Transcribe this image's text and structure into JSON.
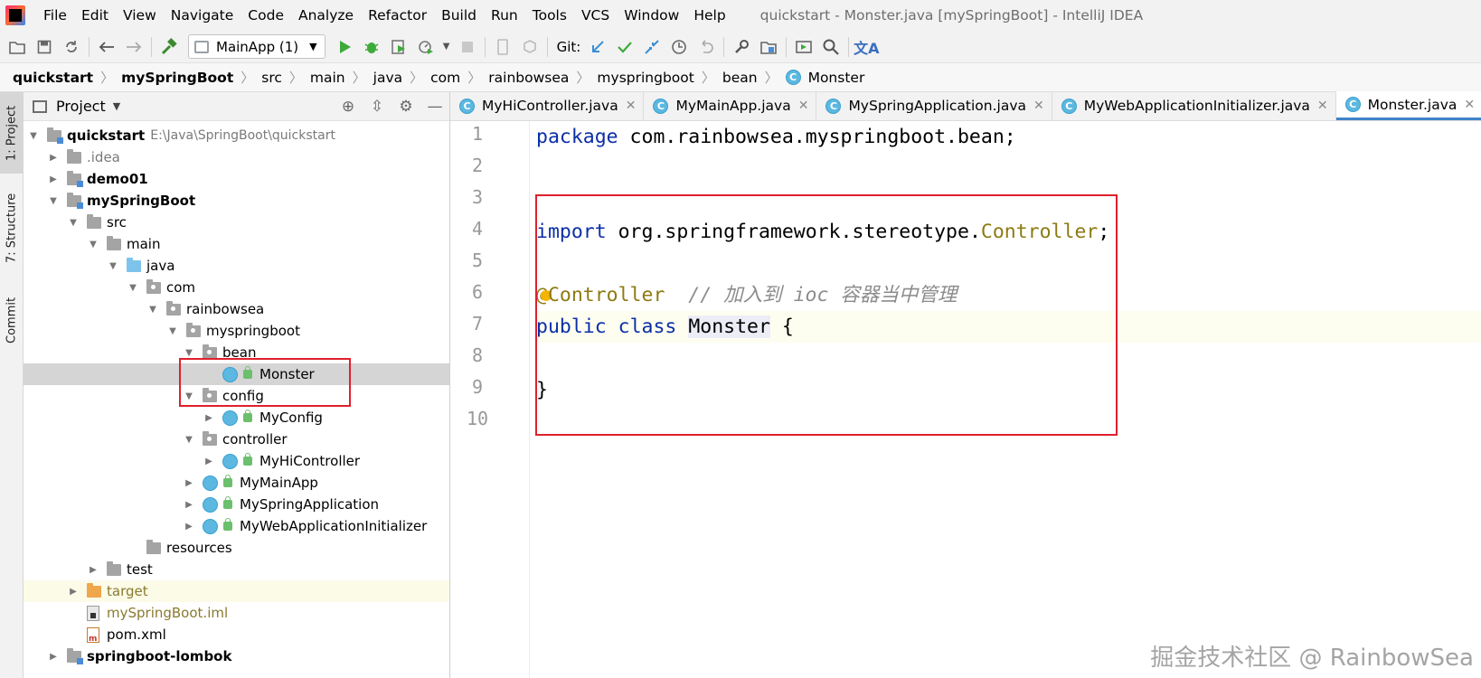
{
  "menu": {
    "items": [
      "File",
      "Edit",
      "View",
      "Navigate",
      "Code",
      "Analyze",
      "Refactor",
      "Build",
      "Run",
      "Tools",
      "VCS",
      "Window",
      "Help"
    ],
    "window_title": "quickstart - Monster.java [mySpringBoot] - IntelliJ IDEA"
  },
  "toolbar": {
    "run_config": "MainApp (1)",
    "git_label": "Git:"
  },
  "breadcrumb": [
    "quickstart",
    "mySpringBoot",
    "src",
    "main",
    "java",
    "com",
    "rainbowsea",
    "myspringboot",
    "bean",
    "Monster"
  ],
  "left_strip": {
    "project_tab": "1: Project",
    "structure_tab": "7: Structure",
    "commit_tab": "Commit"
  },
  "project_panel": {
    "title": "Project",
    "tree": [
      {
        "label": "quickstart",
        "path": "E:\\Java\\SpringBoot\\quickstart"
      },
      {
        "label": ".idea"
      },
      {
        "label": "demo01"
      },
      {
        "label": "mySpringBoot"
      },
      {
        "label": "src"
      },
      {
        "label": "main"
      },
      {
        "label": "java"
      },
      {
        "label": "com"
      },
      {
        "label": "rainbowsea"
      },
      {
        "label": "myspringboot"
      },
      {
        "label": "bean"
      },
      {
        "label": "Monster"
      },
      {
        "label": "config"
      },
      {
        "label": "MyConfig"
      },
      {
        "label": "controller"
      },
      {
        "label": "MyHiController"
      },
      {
        "label": "MyMainApp"
      },
      {
        "label": "MySpringApplication"
      },
      {
        "label": "MyWebApplicationInitializer"
      },
      {
        "label": "resources"
      },
      {
        "label": "test"
      },
      {
        "label": "target"
      },
      {
        "label": "mySpringBoot.iml"
      },
      {
        "label": "pom.xml"
      },
      {
        "label": "springboot-lombok"
      }
    ]
  },
  "editor": {
    "tabs": [
      "MyHiController.java",
      "MyMainApp.java",
      "MySpringApplication.java",
      "MyWebApplicationInitializer.java",
      "Monster.java"
    ],
    "line_numbers": [
      "1",
      "2",
      "3",
      "4",
      "5",
      "6",
      "7",
      "8",
      "9",
      "10"
    ],
    "code": {
      "l1_kw": "package",
      "l1_rest": " com.rainbowsea.myspringboot.bean;",
      "l4_kw": "import",
      "l4_rest": " org.springframework.stereotype.",
      "l4_ann": "Controller",
      "l4_end": ";",
      "l6_at": "@",
      "l6_ann": "Controller",
      "l6_comment": "  // 加入到 ioc 容器当中管理",
      "l7_kw1": "public",
      "l7_kw2": "class",
      "l7_name": "Monster",
      "l7_brace": "{",
      "l9_brace": "}"
    }
  },
  "watermark": "掘金技术社区 @ RainbowSea"
}
